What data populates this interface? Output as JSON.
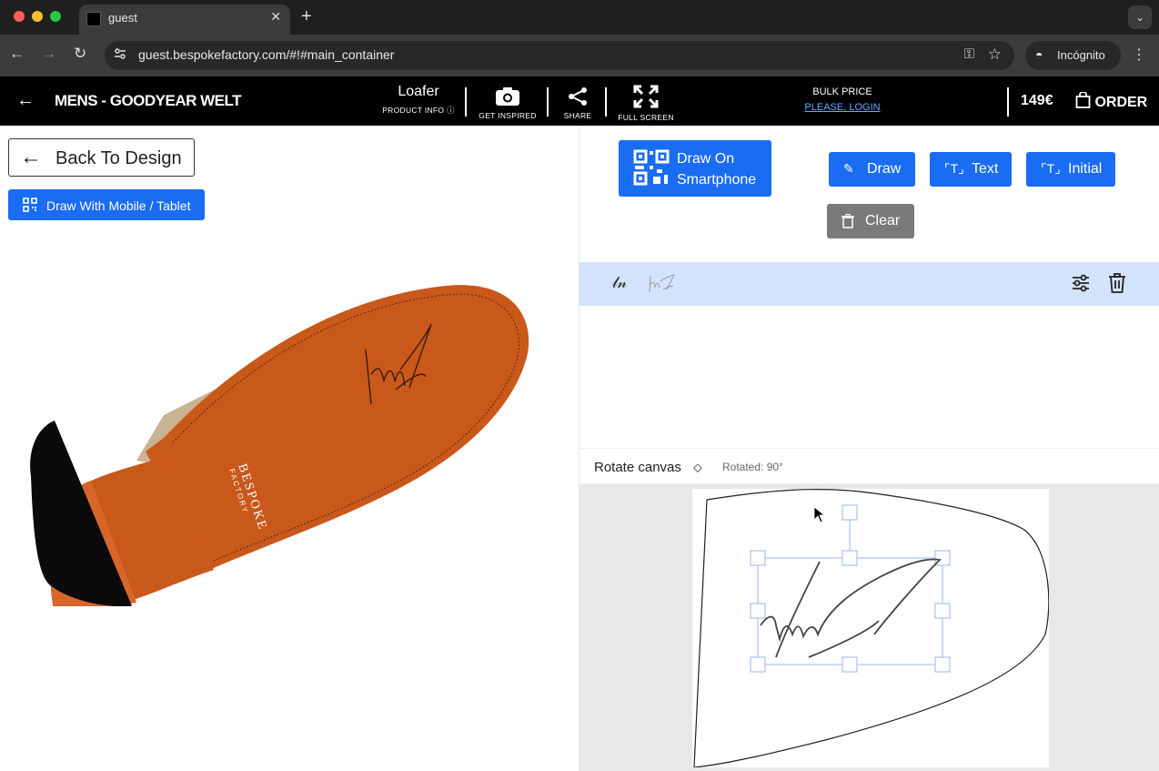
{
  "browser": {
    "tab_title": "guest",
    "url": "guest.bespokefactory.com/#!#main_container",
    "profile_label": "Incógnito"
  },
  "header": {
    "model_name": "MENS - GOODYEAR WELT",
    "product_name": "Loafer",
    "product_info_label": "PRODUCT INFO",
    "inspired_label": "GET INSPIRED",
    "share_label": "SHARE",
    "fullscreen_label": "FULL SCREEN",
    "bulk_price_label": "BULK PRICE",
    "login_label": "PLEASE, LOGIN",
    "price": "149€",
    "order_label": "ORDER"
  },
  "left": {
    "back_label": "Back To Design",
    "mobile_label": "Draw With Mobile / Tablet",
    "sole_brand": "BESPOKE",
    "sole_brand_sub": "FACTORY"
  },
  "right": {
    "smartphone_label_1": "Draw On",
    "smartphone_label_2": "Smartphone",
    "draw_label": "Draw",
    "text_label": "Text",
    "initial_label": "Initial",
    "clear_label": "Clear",
    "rotate_label": "Rotate canvas",
    "rotated_value": "Rotated: 90°"
  },
  "colors": {
    "accent": "#1a6cf2",
    "sole": "#c9581b",
    "layer_selected": "#d3e3fb"
  }
}
